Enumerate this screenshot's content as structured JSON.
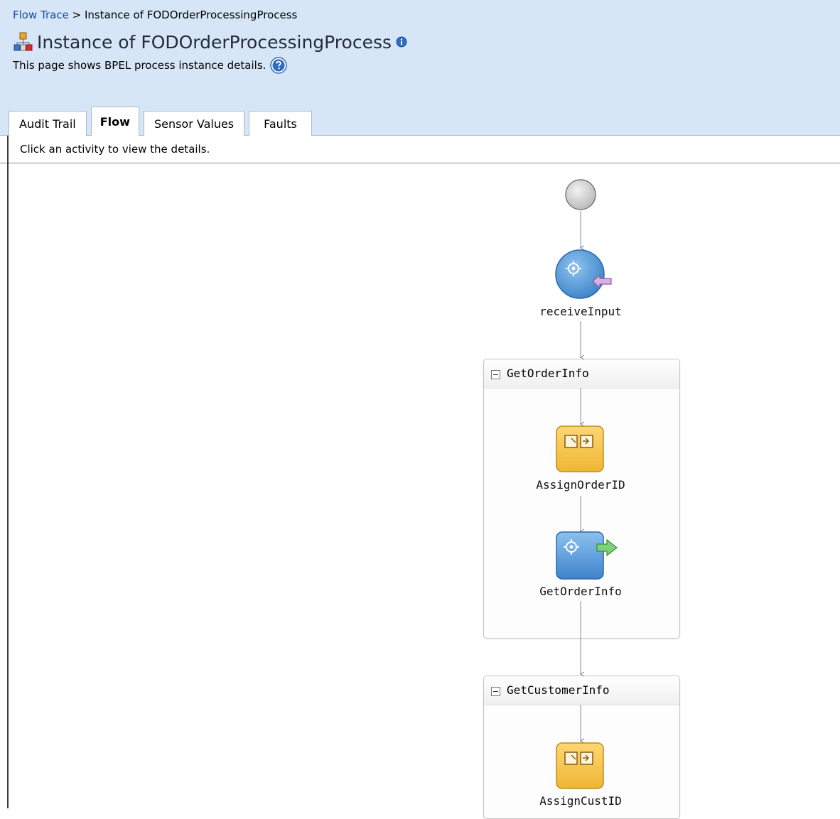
{
  "breadcrumb": {
    "link": "Flow Trace",
    "separator": ">",
    "current": "Instance of FODOrderProcessingProcess"
  },
  "header": {
    "title": "Instance of FODOrderProcessingProcess",
    "description": "This page shows BPEL process instance details.",
    "title_icon": "process-instance-icon",
    "info_icon": "info-icon",
    "help_icon": "help-icon"
  },
  "tabs": [
    {
      "label": "Audit Trail",
      "active": false
    },
    {
      "label": "Flow",
      "active": true
    },
    {
      "label": "Sensor Values",
      "active": false
    },
    {
      "label": "Faults",
      "active": false
    }
  ],
  "instruction": "Click an activity to view the details.",
  "flow": {
    "start": {
      "icon": "start-circle-icon"
    },
    "receive": {
      "label": "receiveInput",
      "icon": "receive-activity-icon"
    },
    "scopes": [
      {
        "title": "GetOrderInfo",
        "activities": [
          {
            "label": "AssignOrderID",
            "icon": "assign-activity-icon"
          },
          {
            "label": "GetOrderInfo",
            "icon": "invoke-activity-icon"
          }
        ]
      },
      {
        "title": "GetCustomerInfo",
        "activities": [
          {
            "label": "AssignCustID",
            "icon": "assign-activity-icon"
          }
        ]
      }
    ]
  },
  "colors": {
    "header_bg": "#d7e6f7",
    "link": "#1a4d9e",
    "receive_blue": "#4a90d0",
    "assign_orange": "#f4c24a",
    "invoke_blue": "#5596d6"
  }
}
